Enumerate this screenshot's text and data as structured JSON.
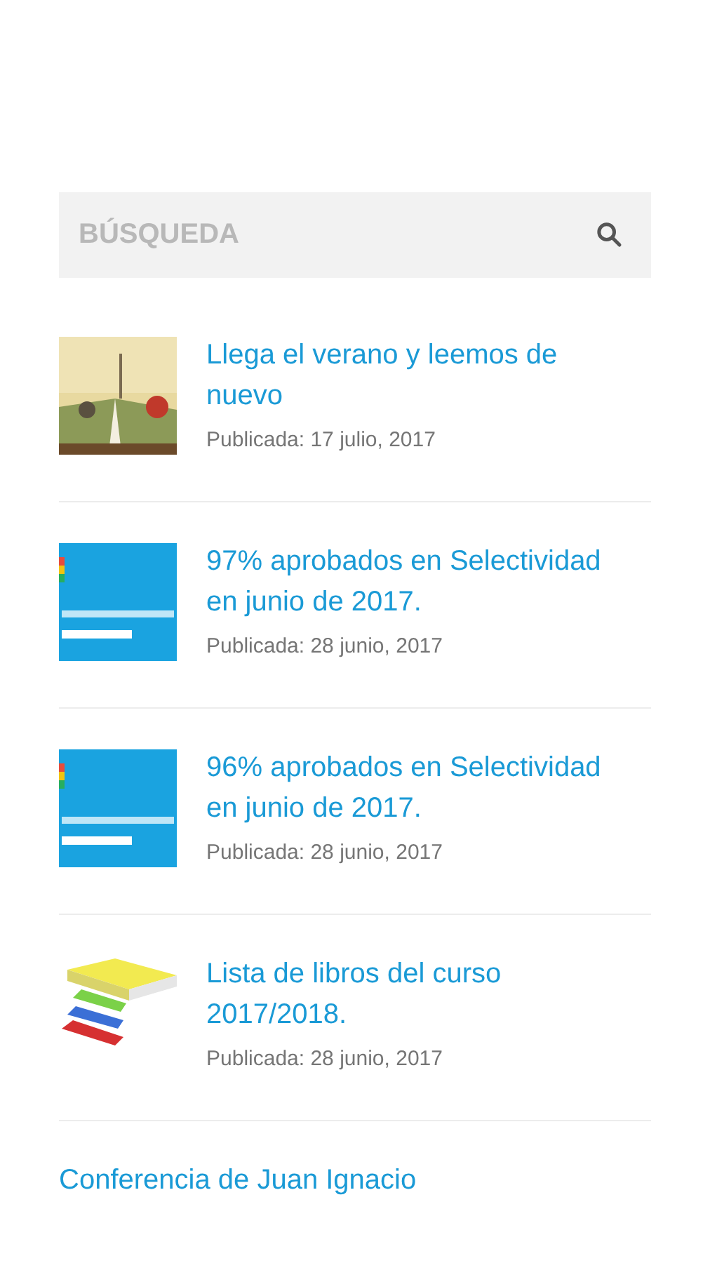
{
  "search": {
    "placeholder": "BÚSQUEDA"
  },
  "posts": [
    {
      "title": "Llega el verano y leemos de nuevo",
      "date": "Publicada: 17 julio, 2017"
    },
    {
      "title": "97% aprobados en Selectividad en junio de 2017.",
      "date": "Publicada: 28 junio, 2017"
    },
    {
      "title": "96% aprobados en Selectividad en junio de 2017.",
      "date": "Publicada: 28 junio, 2017"
    },
    {
      "title": "Lista de libros del curso 2017/2018.",
      "date": "Publicada: 28 junio, 2017"
    },
    {
      "title": "Conferencia de Juan Ignacio"
    }
  ]
}
